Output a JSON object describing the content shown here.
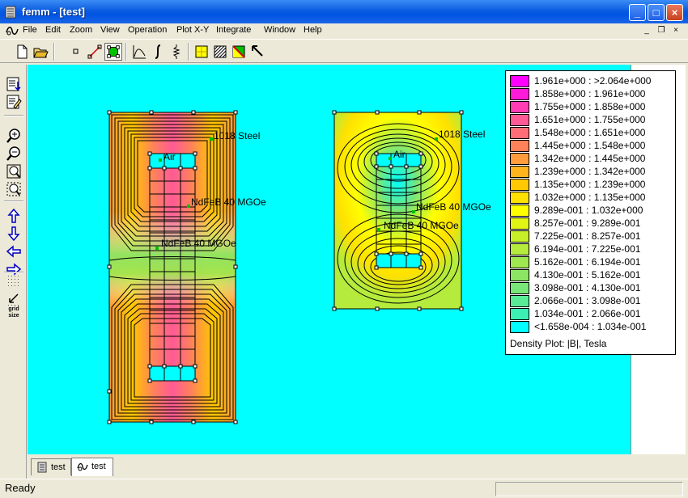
{
  "window": {
    "title": "femm - [test]",
    "app_icon": "femm-icon"
  },
  "menu": [
    "File",
    "Edit",
    "Zoom",
    "View",
    "Operation",
    "Plot X-Y",
    "Integrate",
    "Window",
    "Help"
  ],
  "toolbar_icons": [
    "new-file-icon",
    "open-file-icon",
    "point-mode-icon",
    "contour-mode-icon",
    "area-mode-icon",
    "plot-xy-icon",
    "integrate-icon",
    "circuit-icon",
    "density-plot-icon",
    "smoothing-icon",
    "vector-plot-icon",
    "select-arrow-icon"
  ],
  "left_toolbar_icons": [
    "show-mesh-icon",
    "edit-props-icon",
    "zoom-in-icon",
    "zoom-out-icon",
    "zoom-natural-icon",
    "zoom-window-icon",
    "pan-up-icon",
    "pan-down-icon",
    "pan-left-icon",
    "pan-right-icon",
    "show-grid-icon",
    "snap-grid-icon"
  ],
  "left_toolbar": {
    "grid_size_label_1": "grid",
    "grid_size_label_2": "size"
  },
  "regions": {
    "left_steel": "1018 Steel",
    "left_air": "Air",
    "left_magnet_1": "NdFeB 40 MGOe",
    "left_magnet_2": "NdFeB 40 MGOe",
    "right_steel": "1018 Steel",
    "right_air": "Air",
    "right_magnet_1": "NdFeB 40 MGOe",
    "right_magnet_2": "NdFeB 40 MGOe"
  },
  "legend": {
    "caption": "Density Plot: |B|, Tesla",
    "rows": [
      {
        "label": "1.961e+000 : >2.064e+000",
        "color": "#ff00ff"
      },
      {
        "label": "1.858e+000 : 1.961e+000",
        "color": "#ff1ad9"
      },
      {
        "label": "1.755e+000 : 1.858e+000",
        "color": "#ff3cb4"
      },
      {
        "label": "1.651e+000 : 1.755e+000",
        "color": "#ff5a96"
      },
      {
        "label": "1.548e+000 : 1.651e+000",
        "color": "#ff6e78"
      },
      {
        "label": "1.445e+000 : 1.548e+000",
        "color": "#ff825a"
      },
      {
        "label": "1.342e+000 : 1.445e+000",
        "color": "#ff9b3c"
      },
      {
        "label": "1.239e+000 : 1.342e+000",
        "color": "#ffb41e"
      },
      {
        "label": "1.135e+000 : 1.239e+000",
        "color": "#ffc800"
      },
      {
        "label": "1.032e+000 : 1.135e+000",
        "color": "#ffe100"
      },
      {
        "label": "9.289e-001 : 1.032e+000",
        "color": "#ffff00"
      },
      {
        "label": "8.257e-001 : 9.289e-001",
        "color": "#e1f514"
      },
      {
        "label": "7.225e-001 : 8.257e-001",
        "color": "#c8f028"
      },
      {
        "label": "6.194e-001 : 7.225e-001",
        "color": "#b4eb3c"
      },
      {
        "label": "5.162e-001 : 6.194e-001",
        "color": "#a0e650"
      },
      {
        "label": "4.130e-001 : 5.162e-001",
        "color": "#8ce664"
      },
      {
        "label": "3.098e-001 : 4.130e-001",
        "color": "#78e678"
      },
      {
        "label": "2.066e-001 : 3.098e-001",
        "color": "#5aeb96"
      },
      {
        "label": "1.034e-001 : 2.066e-001",
        "color": "#3cf0b4"
      },
      {
        "label": "<1.658e-004 : 1.034e-001",
        "color": "#00ffff"
      }
    ]
  },
  "tabs": [
    {
      "label": "test",
      "icon": "femm-doc-icon",
      "active": false
    },
    {
      "label": "test",
      "icon": "femm-view-icon",
      "active": true
    }
  ],
  "status": {
    "text": "Ready"
  },
  "colors": {
    "canvas_bg": "#00ffff",
    "titlebar": "#0054e3",
    "contour": "#000000"
  }
}
